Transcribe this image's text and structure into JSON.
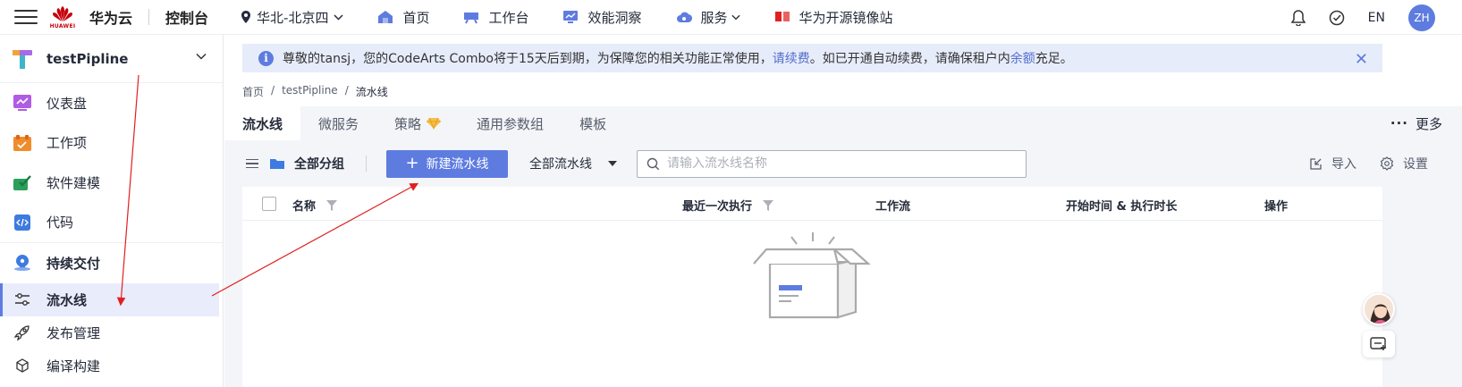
{
  "topbar": {
    "logo_text": "HUAWEI",
    "brand": "华为云",
    "console": "控制台",
    "region": "华北-北京四",
    "nav": [
      {
        "label": "首页",
        "icon": "home-icon"
      },
      {
        "label": "工作台",
        "icon": "workbench-icon"
      },
      {
        "label": "效能洞察",
        "icon": "insight-icon"
      },
      {
        "label": "服务",
        "icon": "service-icon"
      },
      {
        "label": "华为开源镜像站",
        "icon": "mirror-icon"
      }
    ],
    "lang": "EN",
    "user_initials": "ZH",
    "accent": "#5e7ce0"
  },
  "sidebar": {
    "project_name": "testPipline",
    "items": [
      {
        "label": "仪表盘",
        "icon": "dashboard-icon"
      },
      {
        "label": "工作项",
        "icon": "workitem-icon"
      },
      {
        "label": "软件建模",
        "icon": "modeling-icon"
      },
      {
        "label": "代码",
        "icon": "code-icon"
      }
    ],
    "section": {
      "label": "持续交付",
      "icon": "delivery-icon"
    },
    "subitems": [
      {
        "label": "流水线",
        "icon": "pipeline-icon",
        "active": true
      },
      {
        "label": "发布管理",
        "icon": "rocket-icon"
      },
      {
        "label": "编译构建",
        "icon": "build-icon"
      }
    ]
  },
  "notice": {
    "prefix": "尊敬的tansj，您的CodeArts Combo将于15天后到期，为保障您的相关功能正常使用，",
    "renew_link": "请续费",
    "middle": "。如已开通自动续费，请确保租户内",
    "balance_link": "余额",
    "suffix": "充足。"
  },
  "breadcrumb": [
    "首页",
    "testPipline",
    "流水线"
  ],
  "tabs": [
    {
      "label": "流水线",
      "active": true
    },
    {
      "label": "微服务"
    },
    {
      "label": "策略"
    },
    {
      "label": "通用参数组"
    },
    {
      "label": "模板"
    }
  ],
  "more_label": "更多",
  "toolbar": {
    "group_label": "全部分组",
    "new_button": "新建流水线",
    "filter_value": "全部流水线",
    "search_placeholder": "请输入流水线名称",
    "import_label": "导入",
    "settings_label": "设置"
  },
  "table": {
    "columns": [
      "名称",
      "最近一次执行",
      "工作流",
      "开始时间 & 执行时长",
      "操作"
    ]
  }
}
